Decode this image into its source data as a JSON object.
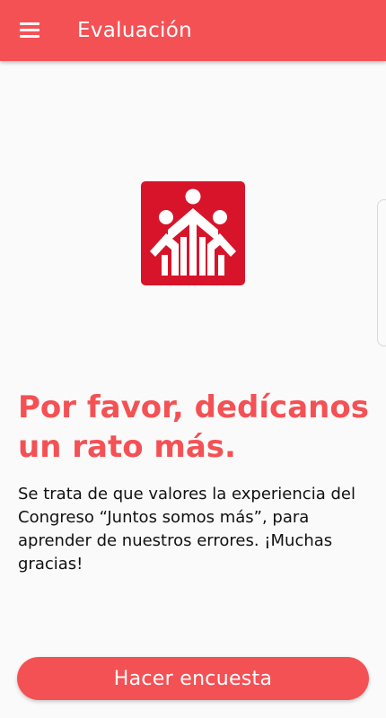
{
  "toolbar": {
    "title": "Evaluación",
    "menu_icon": "menu-icon",
    "color": "#f45155"
  },
  "logo": {
    "icon": "people-logo-icon",
    "color": "#d7142a"
  },
  "content": {
    "headline": "Por favor, dedícanos un rato más.",
    "body": "Se trata de que valores la experiencia del Congreso “Juntos somos más”, para aprender de nuestros errores. ¡Muchas gracias!"
  },
  "actions": {
    "survey_button_label": "Hacer encuesta"
  }
}
